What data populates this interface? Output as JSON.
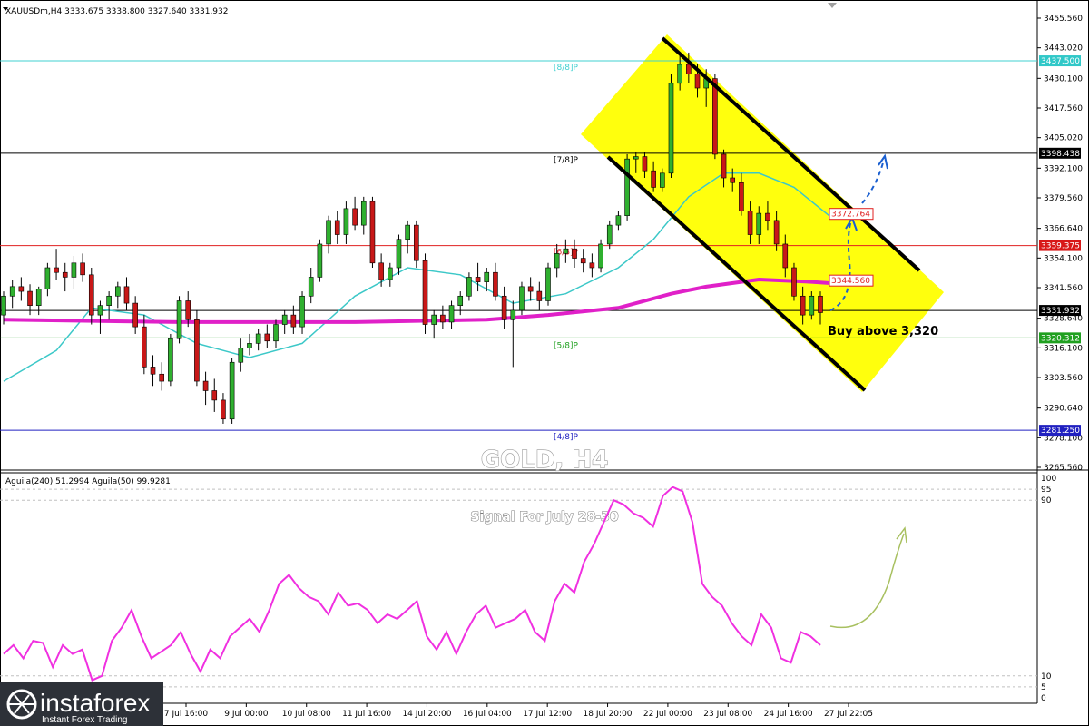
{
  "header": {
    "symbol_line": "XAUUSDm,H4  3333.675 3338.800 3327.640 3331.932",
    "indicator_line": "Aguila(240) 51.2994  Aguila(50) 99.9281"
  },
  "watermark": "GOLD, H4",
  "signal_text": "Signal For July 28-30",
  "buy_text": "Buy above  3,320",
  "logo": {
    "name": "instaforex",
    "tagline": "Instant Forex Trading"
  },
  "colors": {
    "bull": "#2fb02f",
    "bear": "#c81818",
    "ma_slow": "#e020c8",
    "ma_fast": "#3cc8c8",
    "channel_fill": "#ffff00",
    "oscillator": "#f030e0",
    "arrow_blue": "#1a5fd0",
    "arrow_olive": "#a8c060"
  },
  "chart_data": {
    "type": "candlestick",
    "price_axis": {
      "min": 3262,
      "max": 3462,
      "ticks": [
        "3455.560",
        "3443.020",
        "3430.100",
        "3417.560",
        "3405.020",
        "3392.100",
        "3379.560",
        "3366.640",
        "3354.100",
        "3341.560",
        "3328.640",
        "3316.100",
        "3303.560",
        "3290.640",
        "3278.100",
        "3265.560"
      ]
    },
    "time_labels": [
      "7 Jul 16:00",
      "9 Jul 00:00",
      "10 Jul 08:00",
      "11 Jul 16:00",
      "14 Jul 20:00",
      "16 Jul 04:00",
      "17 Jul 12:00",
      "18 Jul 20:00",
      "22 Jul 00:00",
      "23 Jul 08:00",
      "24 Jul 16:00",
      "27 Jul 22:05"
    ],
    "candles": [
      [
        3330,
        3340,
        3326,
        3338
      ],
      [
        3338,
        3345,
        3333,
        3342
      ],
      [
        3342,
        3346,
        3336,
        3340
      ],
      [
        3340,
        3343,
        3330,
        3334
      ],
      [
        3334,
        3342,
        3330,
        3341
      ],
      [
        3341,
        3352,
        3338,
        3350
      ],
      [
        3350,
        3358,
        3345,
        3348
      ],
      [
        3348,
        3352,
        3340,
        3346
      ],
      [
        3346,
        3355,
        3341,
        3352
      ],
      [
        3352,
        3356,
        3344,
        3347
      ],
      [
        3347,
        3350,
        3326,
        3330
      ],
      [
        3330,
        3336,
        3322,
        3334
      ],
      [
        3334,
        3340,
        3328,
        3338
      ],
      [
        3338,
        3344,
        3333,
        3342
      ],
      [
        3342,
        3346,
        3332,
        3335
      ],
      [
        3335,
        3338,
        3322,
        3325
      ],
      [
        3325,
        3330,
        3305,
        3308
      ],
      [
        3308,
        3313,
        3300,
        3305
      ],
      [
        3305,
        3310,
        3298,
        3302
      ],
      [
        3302,
        3322,
        3300,
        3320
      ],
      [
        3320,
        3338,
        3318,
        3336
      ],
      [
        3336,
        3340,
        3325,
        3328
      ],
      [
        3328,
        3332,
        3300,
        3302
      ],
      [
        3302,
        3306,
        3292,
        3298
      ],
      [
        3298,
        3303,
        3289,
        3294
      ],
      [
        3294,
        3297,
        3284,
        3286
      ],
      [
        3286,
        3312,
        3284,
        3310
      ],
      [
        3310,
        3320,
        3306,
        3316
      ],
      [
        3316,
        3322,
        3313,
        3318
      ],
      [
        3318,
        3324,
        3315,
        3322
      ],
      [
        3322,
        3326,
        3316,
        3319
      ],
      [
        3319,
        3328,
        3316,
        3326
      ],
      [
        3326,
        3332,
        3322,
        3330
      ],
      [
        3330,
        3334,
        3322,
        3325
      ],
      [
        3325,
        3340,
        3322,
        3338
      ],
      [
        3338,
        3350,
        3335,
        3346
      ],
      [
        3346,
        3362,
        3344,
        3360
      ],
      [
        3360,
        3372,
        3356,
        3370
      ],
      [
        3370,
        3374,
        3360,
        3364
      ],
      [
        3364,
        3378,
        3360,
        3375
      ],
      [
        3375,
        3380,
        3366,
        3368
      ],
      [
        3368,
        3380,
        3364,
        3378
      ],
      [
        3378,
        3380,
        3350,
        3352
      ],
      [
        3352,
        3356,
        3342,
        3345
      ],
      [
        3345,
        3352,
        3342,
        3350
      ],
      [
        3350,
        3364,
        3347,
        3362
      ],
      [
        3362,
        3370,
        3356,
        3368
      ],
      [
        3368,
        3370,
        3350,
        3353
      ],
      [
        3353,
        3356,
        3322,
        3326
      ],
      [
        3326,
        3332,
        3320,
        3330
      ],
      [
        3330,
        3334,
        3324,
        3327
      ],
      [
        3327,
        3336,
        3324,
        3334
      ],
      [
        3334,
        3340,
        3330,
        3338
      ],
      [
        3338,
        3348,
        3336,
        3346
      ],
      [
        3346,
        3352,
        3340,
        3344
      ],
      [
        3344,
        3350,
        3340,
        3348
      ],
      [
        3348,
        3352,
        3336,
        3338
      ],
      [
        3338,
        3342,
        3324,
        3328
      ],
      [
        3328,
        3336,
        3308,
        3332
      ],
      [
        3332,
        3344,
        3330,
        3342
      ],
      [
        3342,
        3346,
        3336,
        3340
      ],
      [
        3340,
        3344,
        3332,
        3336
      ],
      [
        3336,
        3352,
        3334,
        3350
      ],
      [
        3350,
        3360,
        3346,
        3356
      ],
      [
        3356,
        3362,
        3352,
        3358
      ],
      [
        3358,
        3362,
        3350,
        3354
      ],
      [
        3354,
        3358,
        3348,
        3352
      ],
      [
        3352,
        3356,
        3346,
        3350
      ],
      [
        3350,
        3362,
        3348,
        3360
      ],
      [
        3360,
        3370,
        3358,
        3368
      ],
      [
        3368,
        3374,
        3366,
        3372
      ],
      [
        3372,
        3398,
        3370,
        3396
      ],
      [
        3396,
        3399,
        3390,
        3397
      ],
      [
        3397,
        3399,
        3388,
        3391
      ],
      [
        3391,
        3395,
        3382,
        3384
      ],
      [
        3384,
        3392,
        3382,
        3390
      ],
      [
        3390,
        3432,
        3388,
        3428
      ],
      [
        3428,
        3440,
        3425,
        3436
      ],
      [
        3436,
        3441,
        3428,
        3432
      ],
      [
        3432,
        3436,
        3422,
        3426
      ],
      [
        3426,
        3434,
        3418,
        3430
      ],
      [
        3430,
        3432,
        3396,
        3398
      ],
      [
        3398,
        3400,
        3384,
        3388
      ],
      [
        3388,
        3392,
        3382,
        3386
      ],
      [
        3386,
        3390,
        3372,
        3374
      ],
      [
        3374,
        3378,
        3360,
        3364
      ],
      [
        3364,
        3376,
        3360,
        3373
      ],
      [
        3373,
        3378,
        3366,
        3370
      ],
      [
        3370,
        3374,
        3357,
        3360
      ],
      [
        3360,
        3364,
        3346,
        3350
      ],
      [
        3350,
        3352,
        3336,
        3338
      ],
      [
        3338,
        3342,
        3326,
        3330
      ],
      [
        3330,
        3340,
        3328,
        3338
      ],
      [
        3338,
        3340,
        3326,
        3331
      ]
    ],
    "ma_slow_points": [
      [
        0,
        3328
      ],
      [
        20,
        3327
      ],
      [
        40,
        3327
      ],
      [
        55,
        3328
      ],
      [
        62,
        3330
      ],
      [
        70,
        3333
      ],
      [
        76,
        3339
      ],
      [
        80,
        3342
      ],
      [
        86,
        3345
      ],
      [
        92,
        3344
      ],
      [
        96,
        3343
      ]
    ],
    "ma_fast_points": [
      [
        0,
        3302
      ],
      [
        6,
        3315
      ],
      [
        10,
        3333
      ],
      [
        16,
        3330
      ],
      [
        22,
        3318
      ],
      [
        28,
        3312
      ],
      [
        34,
        3318
      ],
      [
        40,
        3338
      ],
      [
        46,
        3350
      ],
      [
        52,
        3347
      ],
      [
        58,
        3335
      ],
      [
        64,
        3339
      ],
      [
        70,
        3350
      ],
      [
        74,
        3362
      ],
      [
        78,
        3380
      ],
      [
        82,
        3390
      ],
      [
        86,
        3390
      ],
      [
        90,
        3384
      ],
      [
        94,
        3372
      ]
    ],
    "levels": [
      {
        "label": "[8/8]P",
        "value": 3437.5,
        "tag": "3437.500",
        "color": "#40d0d0",
        "tag_color": "#30c8c8"
      },
      {
        "label": "[7/8]P",
        "value": 3398.438,
        "tag": "3398.438",
        "color": "#000000",
        "tag_color": "#000000"
      },
      {
        "label": "[6/8]P",
        "value": 3359.375,
        "tag": "3359.375",
        "color": "#e02020",
        "tag_color": "#d81818"
      },
      {
        "label": "",
        "value": 3331.932,
        "tag": "3331.932",
        "color": "#000000",
        "tag_color": "#000000"
      },
      {
        "label": "[5/8]P",
        "value": 3320.312,
        "tag": "3320.312",
        "color": "#20a020",
        "tag_color": "#20a020"
      },
      {
        "label": "[4/8]P",
        "value": 3281.25,
        "tag": "3281.250",
        "color": "#2020c0",
        "tag_color": "#2020c0"
      }
    ],
    "annotations": [
      {
        "label": "3372.764",
        "value": 3372.764
      },
      {
        "label": "3344.560",
        "value": 3344.56
      }
    ],
    "oscillator": {
      "scale_ticks": [
        "100",
        "95",
        "90",
        "10",
        "5",
        "0"
      ],
      "values": [
        20,
        24,
        18,
        26,
        25,
        14,
        24,
        20,
        22,
        8,
        10,
        26,
        32,
        40,
        28,
        18,
        21,
        24,
        30,
        20,
        12,
        22,
        18,
        28,
        32,
        36,
        30,
        40,
        52,
        56,
        50,
        46,
        44,
        38,
        48,
        42,
        43,
        40,
        34,
        38,
        36,
        40,
        44,
        28,
        22,
        30,
        20,
        30,
        38,
        42,
        32,
        34,
        36,
        40,
        30,
        26,
        44,
        52,
        48,
        62,
        70,
        80,
        90,
        88,
        84,
        82,
        78,
        92,
        96,
        94,
        80,
        52,
        46,
        42,
        34,
        28,
        24,
        38,
        32,
        18,
        16,
        30,
        28,
        24
      ]
    }
  }
}
